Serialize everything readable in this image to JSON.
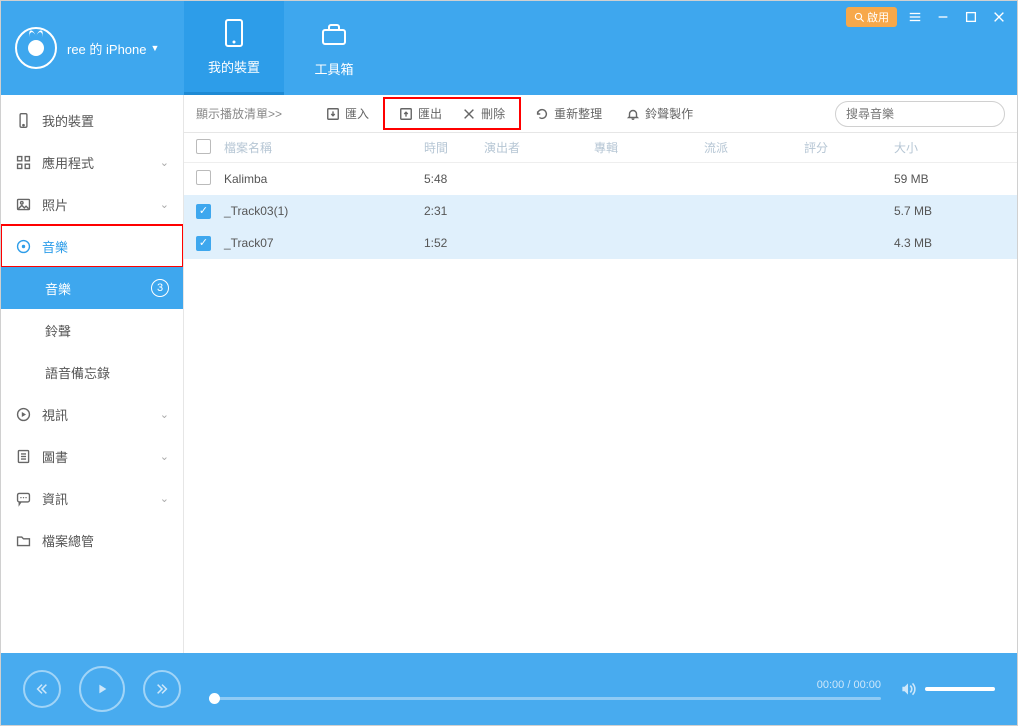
{
  "header": {
    "device_label": "ree 的 iPhone",
    "tabs": [
      {
        "label": "我的裝置"
      },
      {
        "label": "工具箱"
      }
    ],
    "enable_badge": "啟用"
  },
  "sidebar": {
    "items": [
      {
        "label": "我的裝置",
        "icon": "device"
      },
      {
        "label": "應用程式",
        "icon": "apps"
      },
      {
        "label": "照片",
        "icon": "photo"
      },
      {
        "label": "音樂",
        "icon": "music"
      },
      {
        "label": "視訊",
        "icon": "video"
      },
      {
        "label": "圖書",
        "icon": "book"
      },
      {
        "label": "資訊",
        "icon": "chat"
      },
      {
        "label": "檔案總管",
        "icon": "folder"
      }
    ],
    "music_subs": [
      {
        "label": "音樂",
        "count": "3"
      },
      {
        "label": "鈴聲"
      },
      {
        "label": "語音備忘錄"
      }
    ]
  },
  "toolbar": {
    "playlist_link": "顯示播放清單>>",
    "import": "匯入",
    "export": "匯出",
    "delete": "刪除",
    "refresh": "重新整理",
    "ringtone": "鈴聲製作",
    "search_placeholder": "搜尋音樂"
  },
  "table": {
    "headers": {
      "name": "檔案名稱",
      "time": "時間",
      "artist": "演出者",
      "album": "專輯",
      "genre": "流派",
      "rating": "評分",
      "size": "大小"
    },
    "rows": [
      {
        "checked": false,
        "name": "Kalimba",
        "time": "5:48",
        "size": "59 MB"
      },
      {
        "checked": true,
        "name": "_Track03(1)",
        "time": "2:31",
        "size": "5.7 MB"
      },
      {
        "checked": true,
        "name": "_Track07",
        "time": "1:52",
        "size": "4.3 MB"
      }
    ]
  },
  "player": {
    "time": "00:00 / 00:00"
  }
}
